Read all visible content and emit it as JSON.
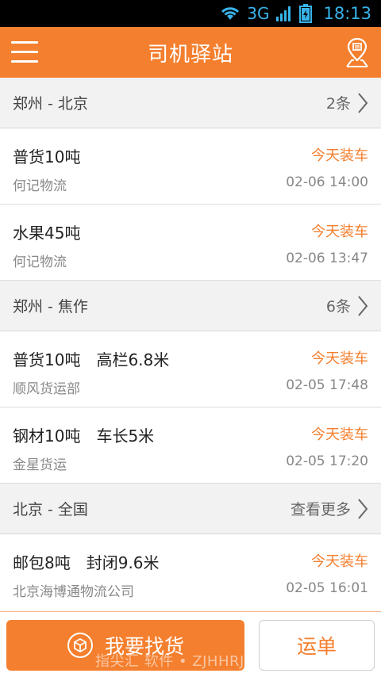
{
  "status_bar": {
    "network": "3G",
    "time": "18:13",
    "icons": [
      "wifi-icon",
      "signal-icon",
      "battery-icon"
    ]
  },
  "app_bar": {
    "title": "司机驿站",
    "menu_icon": "menu-icon",
    "map_icon": "map-pin-icon"
  },
  "groups": [
    {
      "route": "郑州 - 北京",
      "more": "2条",
      "items": [
        {
          "cargo": "普货10吨",
          "company": "何记物流",
          "load": "今天装车",
          "time": "02-06 14:00"
        },
        {
          "cargo": "水果45吨",
          "company": "何记物流",
          "load": "今天装车",
          "time": "02-06 13:47"
        }
      ]
    },
    {
      "route": "郑州 - 焦作",
      "more": "6条",
      "items": [
        {
          "cargo": "普货10吨　高栏6.8米",
          "company": "顺风货运部",
          "load": "今天装车",
          "time": "02-05 17:48"
        },
        {
          "cargo": "钢材10吨　车长5米",
          "company": "金星货运",
          "load": "今天装车",
          "time": "02-05 17:20"
        }
      ]
    },
    {
      "route": "北京 - 全国",
      "more": "查看更多",
      "items": [
        {
          "cargo": "邮包8吨　封闭9.6米",
          "company": "北京海博通物流公司",
          "load": "今天装车",
          "time": "02-05 16:01"
        }
      ]
    }
  ],
  "bottom_bar": {
    "find_cargo": "我要找货",
    "waybill": "运单"
  },
  "watermark": "指尖汇 软件 • ZJHHRJ.COM",
  "colors": {
    "accent": "#f47f2e",
    "status_icon": "#38b4ea"
  }
}
